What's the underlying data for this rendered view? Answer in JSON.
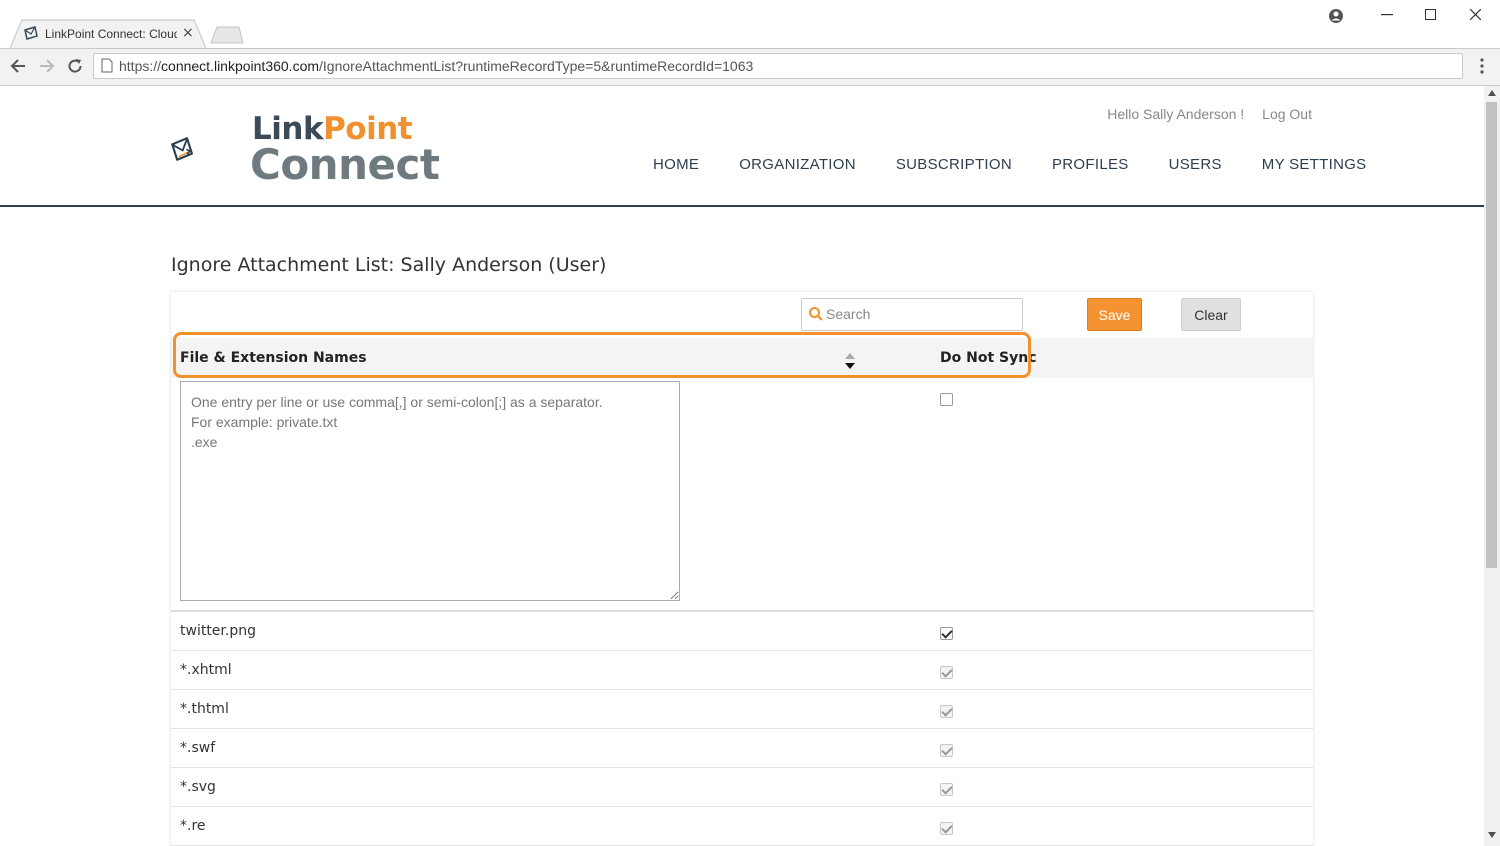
{
  "browser": {
    "tab_title": "LinkPoint Connect: Cloud",
    "tab_close": "×",
    "url_scheme": "https://",
    "url_host": "connect.linkpoint360.com",
    "url_path": "/IgnoreAttachmentList?runtimeRecordType=5&runtimeRecordId=1063"
  },
  "header": {
    "logo_link_1": "Link",
    "logo_link_2": "Point",
    "logo_connect": "Connect",
    "greeting": "Hello Sally Anderson !",
    "logout": "Log Out",
    "nav": [
      "HOME",
      "ORGANIZATION",
      "SUBSCRIPTION",
      "PROFILES",
      "USERS",
      "MY SETTINGS"
    ]
  },
  "main": {
    "title": "Ignore Attachment List: Sally Anderson (User)",
    "search_placeholder": "Search",
    "save_label": "Save",
    "clear_label": "Clear",
    "columns": {
      "name": "File & Extension Names",
      "sync": "Do Not Sync"
    },
    "entry_placeholder": "One entry per line or use comma[,] or semi-colon[;] as a separator.\nFor example: private.txt\n.exe",
    "rows": [
      {
        "name": "twitter.png",
        "checked": true,
        "disabled": false
      },
      {
        "name": "*.xhtml",
        "checked": true,
        "disabled": true
      },
      {
        "name": "*.thtml",
        "checked": true,
        "disabled": true
      },
      {
        "name": "*.swf",
        "checked": true,
        "disabled": true
      },
      {
        "name": "*.svg",
        "checked": true,
        "disabled": true
      },
      {
        "name": "*.re",
        "checked": true,
        "disabled": true
      }
    ]
  },
  "colors": {
    "accent": "#f0912e",
    "save": "#f59331",
    "navy": "#2d3e4e"
  }
}
